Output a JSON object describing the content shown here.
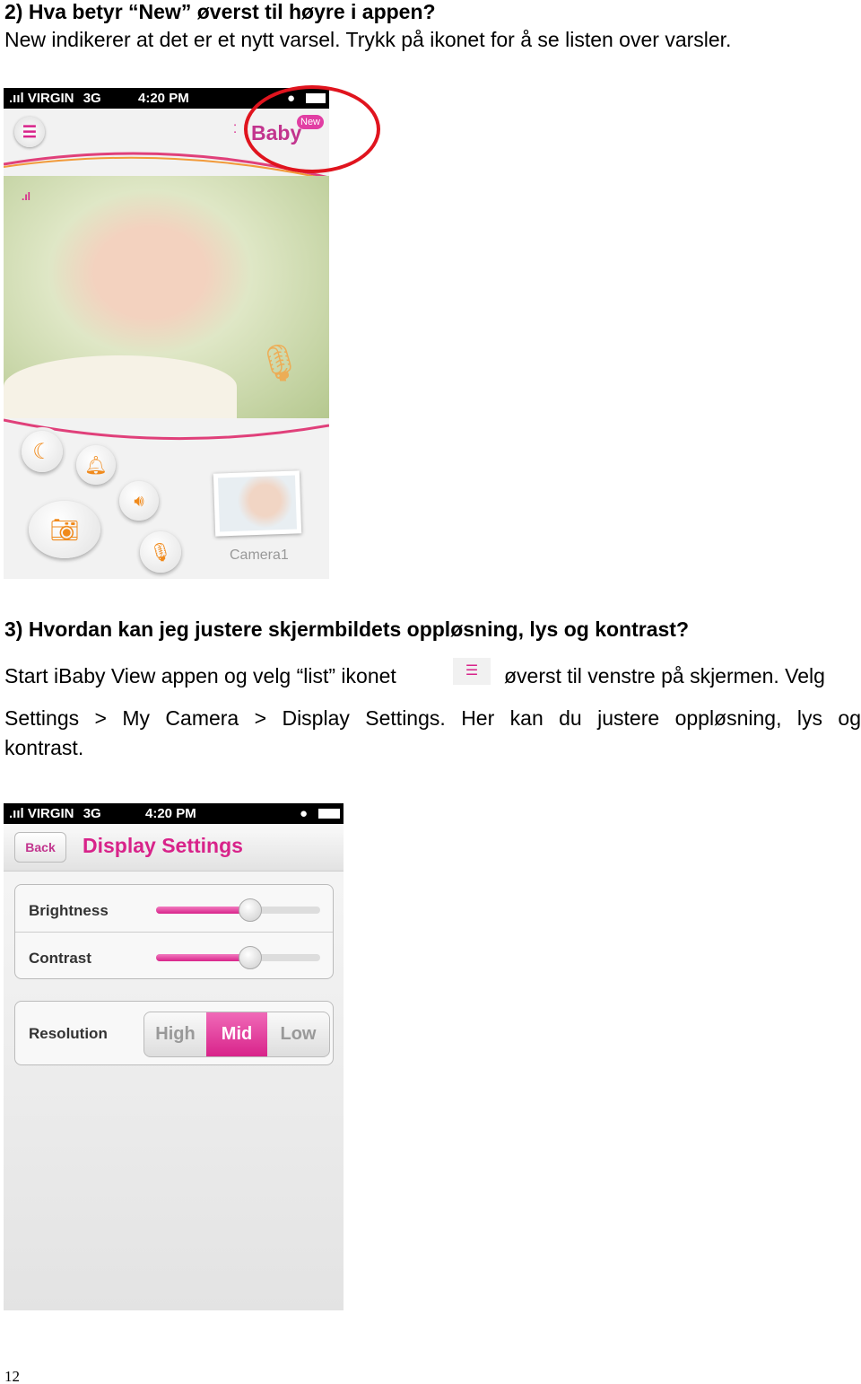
{
  "q2": {
    "heading": "2)   Hva betyr “New” øverst til høyre i appen?",
    "body": "New indikerer at det er et nytt varsel. Trykk på ikonet for å se listen over varsler."
  },
  "phone1": {
    "carrier": "VIRGIN",
    "network": "3G",
    "time": "4:20 PM",
    "logo": "Baby",
    "badge": "New",
    "camera_label": "Camera1",
    "highlight_color": "#e0141e",
    "accent": "#d8238a",
    "icon_color": "#f08a1c"
  },
  "q3": {
    "heading": "3)   Hvordan kan jeg justere skjermbildets oppløsning, lys og kontrast?",
    "line1a": "Start iBaby View appen og velg “list” ikonet",
    "line1b": "øverst til venstre på skjermen. Velg",
    "line2": "Settings > My Camera > Display Settings. Her kan du justere oppløsning, lys og",
    "line3": "kontrast."
  },
  "phone2": {
    "carrier": "VIRGIN",
    "network": "3G",
    "time": "4:20 PM",
    "back": "Back",
    "title": "Display Settings",
    "brightness_label": "Brightness",
    "brightness_level": 0.57,
    "contrast_label": "Contrast",
    "contrast_level": 0.57,
    "resolution_label": "Resolution",
    "resolution_options": [
      "High",
      "Mid",
      "Low"
    ],
    "resolution_selected": "Mid"
  },
  "page_number": "12"
}
